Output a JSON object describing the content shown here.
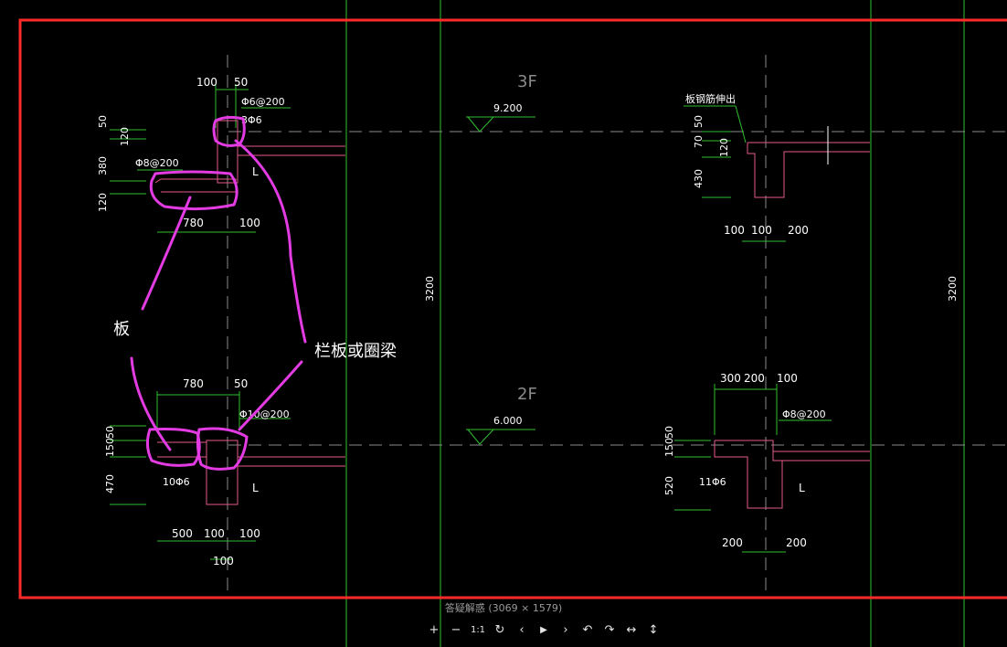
{
  "viewer": {
    "caption": "答疑解惑 (3069 × 1579)",
    "toolbar": [
      {
        "name": "zoom-in-button",
        "glyph": "+"
      },
      {
        "name": "zoom-out-button",
        "glyph": "−"
      },
      {
        "name": "actual-size-button",
        "glyph": "1:1"
      },
      {
        "name": "reset-button",
        "glyph": "↻"
      },
      {
        "name": "prev-button",
        "glyph": "‹"
      },
      {
        "name": "play-button",
        "glyph": "▶"
      },
      {
        "name": "next-button",
        "glyph": "›"
      },
      {
        "name": "rotate-left-button",
        "glyph": "↶"
      },
      {
        "name": "rotate-right-button",
        "glyph": "↷"
      },
      {
        "name": "flip-horizontal-button",
        "glyph": "↔"
      },
      {
        "name": "flip-vertical-button",
        "glyph": "↕"
      }
    ]
  },
  "drawing": {
    "levels": [
      {
        "name": "3F",
        "elevation": "9.200"
      },
      {
        "name": "2F",
        "elevation": "6.000"
      }
    ],
    "story_height": "3200",
    "annotations": {
      "slab": "板",
      "parapet": "栏板或圈梁"
    },
    "labels": {
      "d1_top_dims": [
        "100",
        "50"
      ],
      "d1_rebar_a": "Φ6@200",
      "d1_rebar_b": "3Φ6",
      "d1_rebar_c": "Φ8@200",
      "d1_left_dims": [
        "50",
        "120",
        "380",
        "120"
      ],
      "d1_bottom_dims": [
        "780",
        "100"
      ],
      "L": "L",
      "d2_top_dims": [
        "780",
        "50"
      ],
      "d2_rebar_a": "Φ10@200",
      "d2_rebar_b": "10Φ6",
      "d2_left_dims": [
        "150",
        "50",
        "470"
      ],
      "d2_bottom_dims": [
        "500",
        "100",
        "100",
        "100"
      ],
      "d3_note": "板钢筋伸出",
      "d3_left_dims": [
        "50",
        "70",
        "120",
        "430"
      ],
      "d3_bottom_dims": [
        "100",
        "100",
        "200"
      ],
      "d4_top_dims": [
        "300",
        "200",
        "100"
      ],
      "d4_rebar_a": "Φ8@200",
      "d4_rebar_b": "11Φ6",
      "d4_left_dims": [
        "150",
        "50",
        "520"
      ],
      "d4_bottom_dims": [
        "200",
        "200"
      ]
    }
  }
}
